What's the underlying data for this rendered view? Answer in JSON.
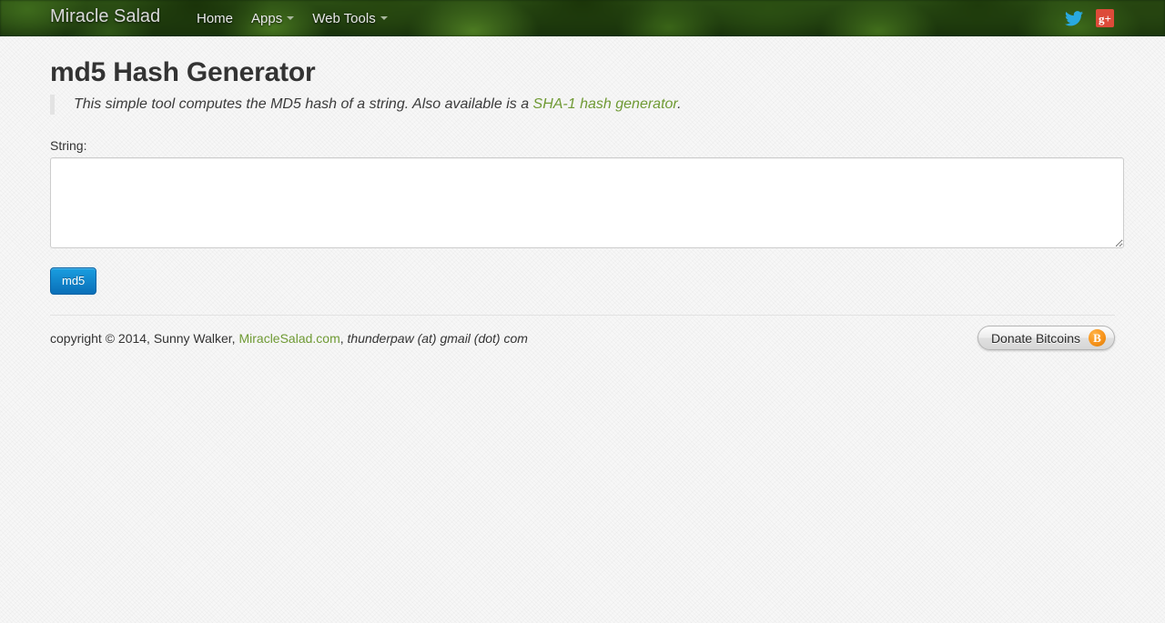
{
  "navbar": {
    "brand": "Miracle Salad",
    "items": [
      {
        "label": "Home",
        "has_caret": false
      },
      {
        "label": "Apps",
        "has_caret": true
      },
      {
        "label": "Web Tools",
        "has_caret": true
      }
    ],
    "social": [
      {
        "name": "twitter-icon",
        "color": "#29a9e0"
      },
      {
        "name": "google-plus-icon",
        "label": "g+",
        "color": "#dd4b39"
      }
    ]
  },
  "main": {
    "title": "md5 Hash Generator",
    "lead_text_before": "This simple tool computes the MD5 hash of a string. Also available is a ",
    "lead_link": "SHA-1 hash generator",
    "lead_text_after": ".",
    "string_label": "String:",
    "string_value": "",
    "string_placeholder": "",
    "submit_label": "md5"
  },
  "footer": {
    "copyright_before": "copyright © 2014, Sunny Walker, ",
    "site_link": "MiracleSalad.com",
    "copyright_mid": ", ",
    "email": "thunderpaw (at) gmail (dot) com",
    "donate_label": "Donate Bitcoins",
    "bitcoin_glyph": "B"
  },
  "colors": {
    "link_green": "#6f9a34",
    "button_blue": "#0a6fb8",
    "bitcoin_orange": "#f7931a",
    "navbar_green": "#1d330f"
  }
}
